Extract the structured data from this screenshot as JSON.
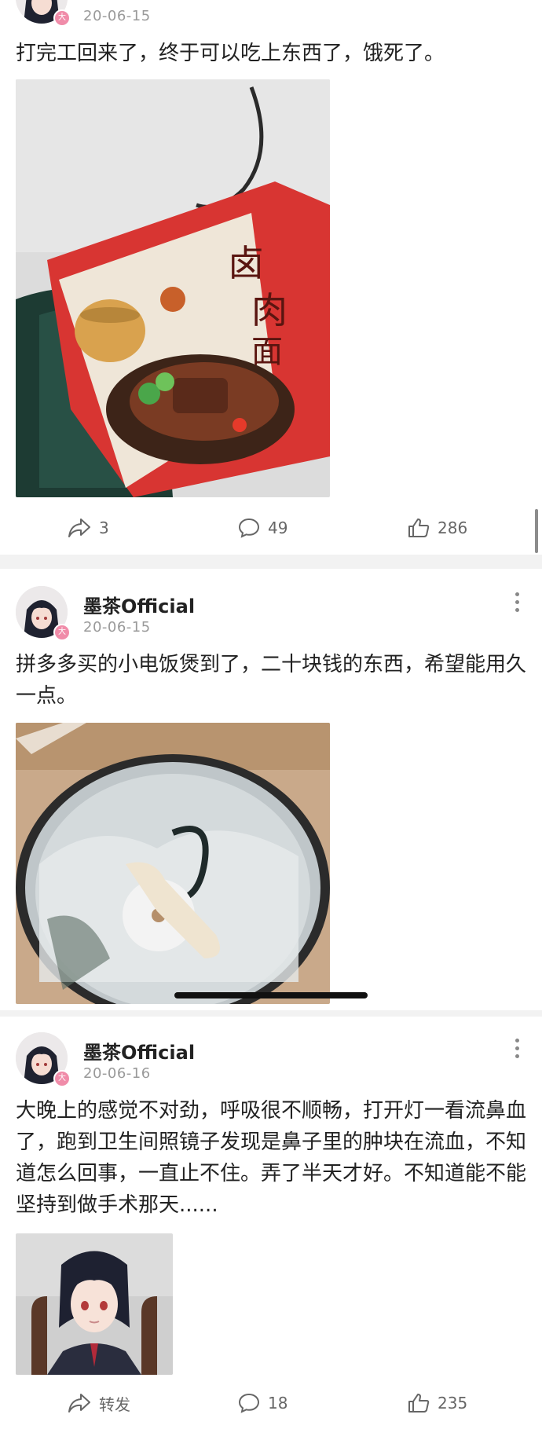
{
  "posts": [
    {
      "username": "",
      "time": "20-06-15",
      "text": "打完工回来了，终于可以吃上东西了，饿死了。",
      "photo": "photo of instant noodle packet on a rice cooker",
      "actions": {
        "repost": "3",
        "comment": "49",
        "like": "286"
      }
    },
    {
      "username": "墨茶Official",
      "time": "20-06-15",
      "text": "拼多多买的小电饭煲到了，二十块钱的东西，希望能用久一点。",
      "photo": "photo of small rice cooker in plastic bag"
    },
    {
      "username": "墨茶Official",
      "time": "20-06-16",
      "text": "大晚上的感觉不对劲，呼吸很不顺畅，打开灯一看流鼻血了，跑到卫生间照镜子发现是鼻子里的肿块在流血，不知道怎么回事，一直止不住。弄了半天才好。不知道能不能坚持到做手术那天......",
      "photo": "anime-style avatar image",
      "actions": {
        "repost": "转发",
        "comment": "18",
        "like": "235"
      }
    }
  ],
  "badge_glyph": "大",
  "colors": {
    "accent": "#ff4a6e",
    "badge": "#f08ca9",
    "muted": "#9a9a9a"
  }
}
